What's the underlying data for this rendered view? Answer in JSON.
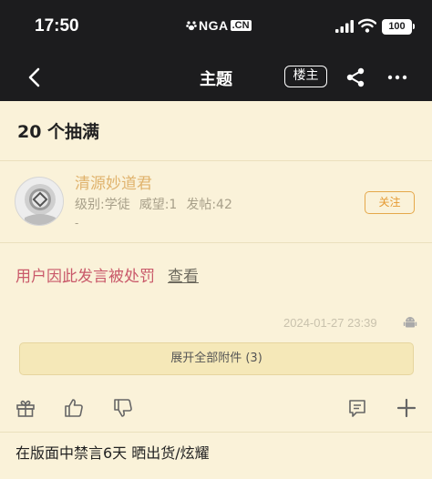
{
  "status_bar": {
    "time": "17:50",
    "logo_text": "NGA",
    "logo_suffix": ".CN",
    "battery": "100"
  },
  "nav": {
    "title": "主题",
    "louzhu_label": "楼主",
    "icons": [
      "back-icon",
      "share-icon",
      "more-icon"
    ]
  },
  "post": {
    "title": "20 个抽满",
    "author": {
      "name": "清源妙道君",
      "level": "级别:学徒",
      "reputation": "威望:1",
      "posts": "发帖:42",
      "extra": "-"
    },
    "follow_label": "关注",
    "punish_text": "用户因此发言被处罚",
    "view_label": "查看",
    "timestamp": "2024-01-27 23:39",
    "attach_label": "展开全部附件 (3)"
  },
  "actions": {
    "icons": [
      "gift-icon",
      "thumbs-up-icon",
      "thumbs-down-icon",
      "comment-icon",
      "plus-icon"
    ]
  },
  "footer": {
    "text": "在版面中禁言6天 晒出货/炫耀"
  },
  "colors": {
    "header_bg": "#1c1c1e",
    "page_bg": "#faf2d9",
    "username": "#e0b36d",
    "follow": "#e59a33",
    "punish": "#c9596a",
    "attach_bg": "#f5e8b8"
  }
}
